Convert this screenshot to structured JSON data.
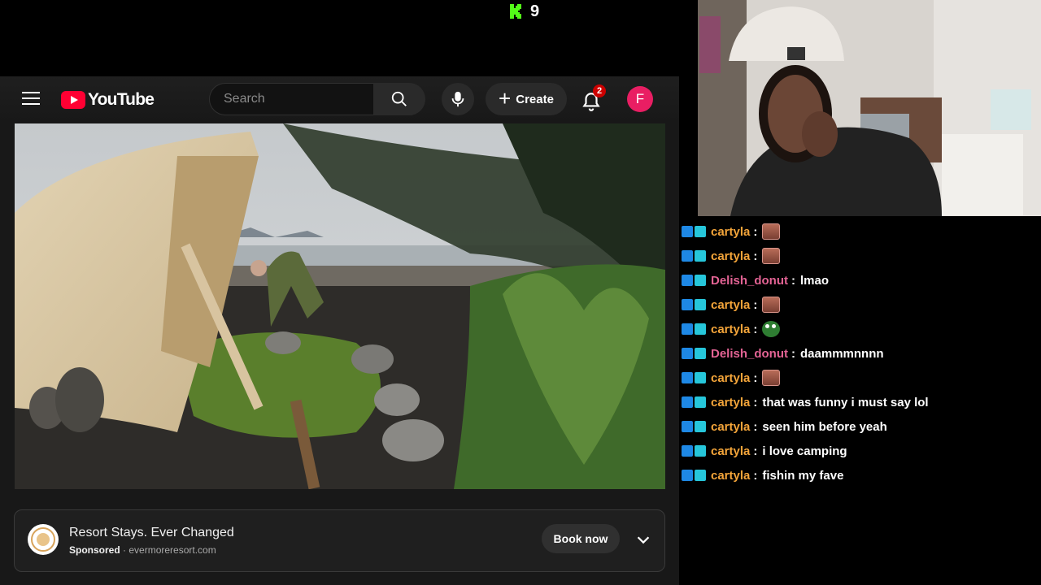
{
  "kick": {
    "viewer_count": "9",
    "brand_color": "#53fc18"
  },
  "youtube": {
    "logo_text": "YouTube",
    "search": {
      "placeholder": "Search",
      "value": ""
    },
    "create_label": "Create",
    "notifications_count": "2",
    "avatar_letter": "F",
    "colors": {
      "brand_red": "#ff0033",
      "avatar": "#e91e63"
    }
  },
  "ad": {
    "title": "Resort Stays. Ever Changed",
    "sponsored_label": "Sponsored",
    "separator": "·",
    "domain": "evermoreresort.com",
    "button_label": "Book now"
  },
  "chat": {
    "messages": [
      {
        "user": "cartyla",
        "color": "#f4a53a",
        "emote": "face"
      },
      {
        "user": "cartyla",
        "color": "#f4a53a",
        "emote": "face"
      },
      {
        "user": "Delish_donut",
        "color": "#e36394",
        "text": "lmao"
      },
      {
        "user": "cartyla",
        "color": "#f4a53a",
        "emote": "face"
      },
      {
        "user": "cartyla",
        "color": "#f4a53a",
        "emote": "frog"
      },
      {
        "user": "Delish_donut",
        "color": "#e36394",
        "text": "daammmnnnn"
      },
      {
        "user": "cartyla",
        "color": "#f4a53a",
        "emote": "face"
      },
      {
        "user": "cartyla",
        "color": "#f4a53a",
        "text": "that was funny i must say lol"
      },
      {
        "user": "cartyla",
        "color": "#f4a53a",
        "text": "seen him before yeah"
      },
      {
        "user": "cartyla",
        "color": "#f4a53a",
        "text": "i love camping"
      },
      {
        "user": "cartyla",
        "color": "#f4a53a",
        "text": "fishin my fave"
      }
    ]
  }
}
